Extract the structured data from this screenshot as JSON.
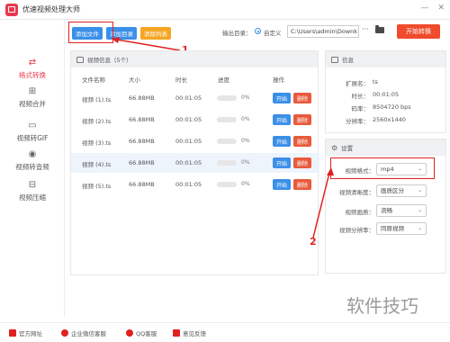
{
  "app": {
    "title": "优速视频处理大师"
  },
  "window_controls": [
    "—",
    "✕"
  ],
  "sidebar": {
    "items": [
      {
        "icon": "format-convert-icon",
        "glyph": "⇄",
        "label": "格式转换",
        "active": true
      },
      {
        "icon": "merge-icon",
        "glyph": "⊞",
        "label": "视频合并",
        "active": false
      },
      {
        "icon": "gif-icon",
        "glyph": "▭",
        "label": "视频转GIF",
        "active": false
      },
      {
        "icon": "audio-icon",
        "glyph": "◉",
        "label": "视频转音频",
        "active": false
      },
      {
        "icon": "compress-icon",
        "glyph": "⊟",
        "label": "视频压缩",
        "active": false
      }
    ]
  },
  "toolbar": {
    "add_file": "添加文件",
    "add_folder": "添加目录",
    "clear_list": "清除列表",
    "output_label": "输出目录：",
    "custom_label": "自定义",
    "output_path": "C:\\Users\\admin\\Downk",
    "browse": "···",
    "start_convert": "开始转换"
  },
  "file_list": {
    "header": "视频信息（5个）",
    "columns": [
      "文件名称",
      "大小",
      "时长",
      "进度",
      "操作"
    ],
    "rows": [
      {
        "name": "视频 (1).ts",
        "size": "66.88MB",
        "duration": "00:01:05",
        "progress": "0%"
      },
      {
        "name": "视频 (2).ts",
        "size": "66.88MB",
        "duration": "00:01:05",
        "progress": "0%"
      },
      {
        "name": "视频 (3).ts",
        "size": "66.88MB",
        "duration": "00:01:05",
        "progress": "0%"
      },
      {
        "name": "视频 (4).ts",
        "size": "66.88MB",
        "duration": "00:01:05",
        "progress": "0%"
      },
      {
        "name": "视频 (5).ts",
        "size": "66.88MB",
        "duration": "00:01:05",
        "progress": "0%"
      }
    ],
    "start_label": "开始",
    "delete_label": "删除",
    "highlighted_row": 3
  },
  "info": {
    "header": "信息",
    "fields": [
      {
        "key": "扩展名：",
        "value": "ts"
      },
      {
        "key": "时长：",
        "value": "00:01:05"
      },
      {
        "key": "码率：",
        "value": "8504720 bps"
      },
      {
        "key": "分辨率：",
        "value": "2560x1440"
      }
    ]
  },
  "settings": {
    "header": "设置",
    "fields": [
      {
        "label": "视频格式：",
        "value": "mp4"
      },
      {
        "label": "视频清晰度：",
        "value": "画质区分"
      },
      {
        "label": "视频画质：",
        "value": "流畅"
      },
      {
        "label": "视频分辨率：",
        "value": "同原视频"
      }
    ]
  },
  "annotations": {
    "marker_1": "1",
    "marker_2": "2",
    "color": "#e02020"
  },
  "footer": {
    "items": [
      "官方网址",
      "企业微信客服",
      "QQ客服",
      "意见反馈"
    ]
  },
  "watermark": "软件技巧",
  "colors": {
    "accent_red": "#e8384f",
    "button_blue": "#3b8fe8",
    "button_orange": "#f5a623",
    "start_red": "#ef4b2c"
  }
}
